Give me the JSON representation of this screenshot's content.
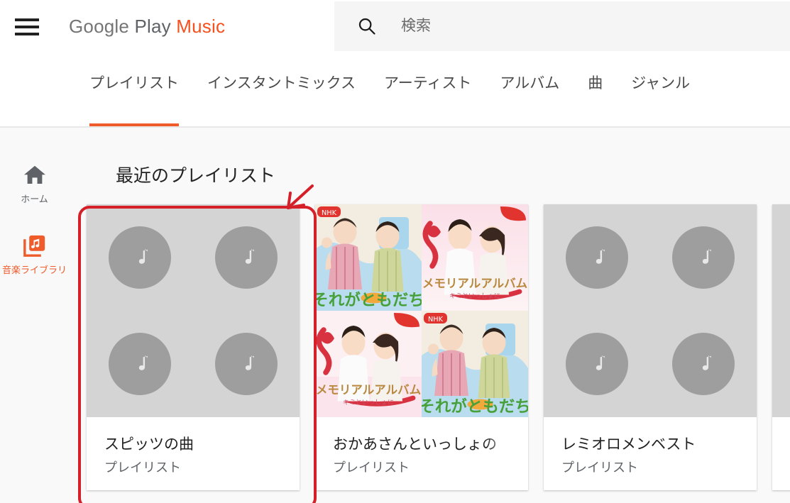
{
  "header": {
    "menu_icon": "hamburger-menu-icon",
    "brand": {
      "part1": "Google",
      "part2": " Play ",
      "part3": "Music"
    },
    "search": {
      "icon": "search-icon",
      "placeholder": "検索",
      "value": ""
    }
  },
  "tabs": [
    {
      "label": "プレイリスト",
      "active": true
    },
    {
      "label": "インスタントミックス",
      "active": false
    },
    {
      "label": "アーティスト",
      "active": false
    },
    {
      "label": "アルバム",
      "active": false
    },
    {
      "label": "曲",
      "active": false
    },
    {
      "label": "ジャンル",
      "active": false
    }
  ],
  "sidebar": {
    "items": [
      {
        "label": "ホーム",
        "icon": "home-icon",
        "active": false
      },
      {
        "label": "音楽ライブラリ",
        "icon": "music-library-icon",
        "active": true
      }
    ]
  },
  "main": {
    "section_title": "最近のプレイリスト",
    "cards": [
      {
        "title": "スピッツの曲",
        "subtitle": "プレイリスト",
        "art_type": "placeholder-notes",
        "highlighted": true
      },
      {
        "title": "おかあさんといっしょの",
        "subtitle": "プレイリスト",
        "art_type": "album-covers",
        "truncated": true,
        "covers": [
          "それがともだち",
          "メモリアルアルバム ～キミといっしょに～",
          "メモリアルアルバム ～キミといっしょに～",
          "それがともだち"
        ]
      },
      {
        "title": "レミオロメンベスト",
        "subtitle": "プレイリスト",
        "art_type": "placeholder-notes",
        "highlighted": false
      },
      {
        "title": "",
        "subtitle": "",
        "art_type": "placeholder-notes",
        "highlighted": false
      }
    ]
  },
  "annotation": {
    "type": "red-highlight-with-arrow",
    "color": "#d5202a",
    "target": "first playlist card"
  },
  "colors": {
    "accent_orange": "#ef5b2b",
    "brand_gray": "#757575",
    "content_bg": "#f9f9f9",
    "card_bg": "#ffffff",
    "placeholder_art": "#d4d4d4",
    "placeholder_circle": "#9e9e9e",
    "annotation_red": "#d5202a"
  }
}
